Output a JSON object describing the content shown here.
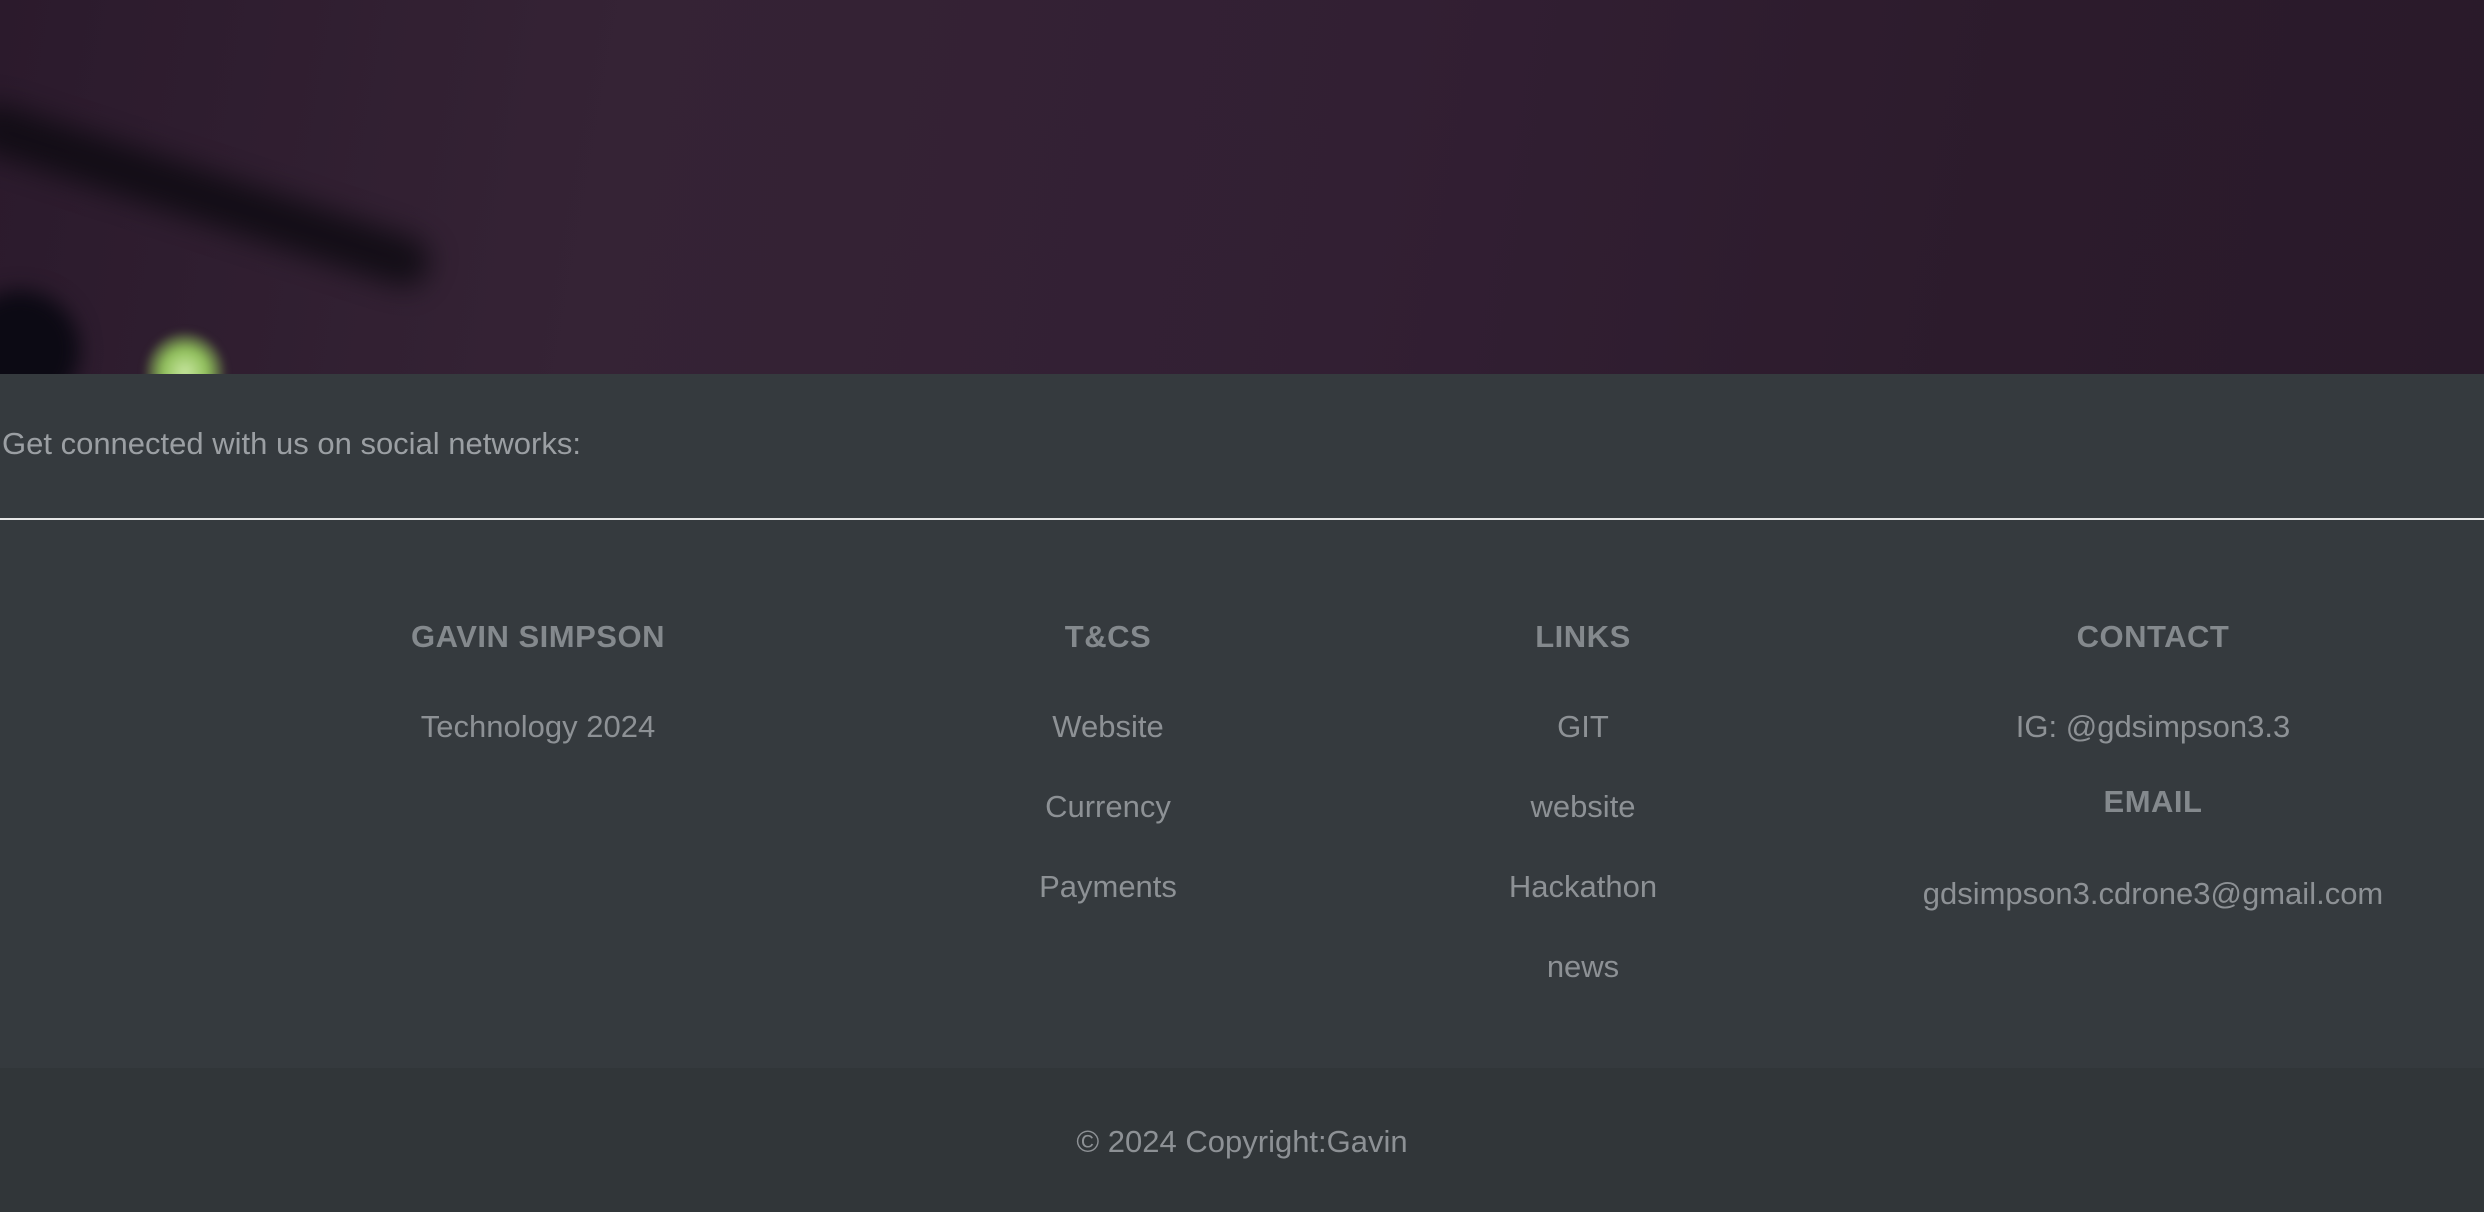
{
  "social": {
    "text": "Get connected with us on social networks:"
  },
  "columns": {
    "brand": {
      "heading": "GAVIN SIMPSON",
      "text": "Technology 2024"
    },
    "terms": {
      "heading": "T&CS",
      "items": [
        "Website",
        "Currency",
        "Payments"
      ]
    },
    "links": {
      "heading": "LINKS",
      "items": [
        "GIT",
        "website",
        "Hackathon",
        "news"
      ]
    },
    "contact": {
      "heading": "CONTACT",
      "instagram": "IG: @gdsimpson3.3",
      "email_heading": "EMAIL",
      "email": "gdsimpson3.cdrone3@gmail.com"
    }
  },
  "copyright": {
    "text": "© 2024 Copyright:Gavin"
  },
  "colors": {
    "footer_bg": "#353a3e",
    "copyright_bg": "#313639",
    "hero_bg": "#321f33",
    "text": "#8d9195",
    "divider": "#e6e6e6"
  }
}
